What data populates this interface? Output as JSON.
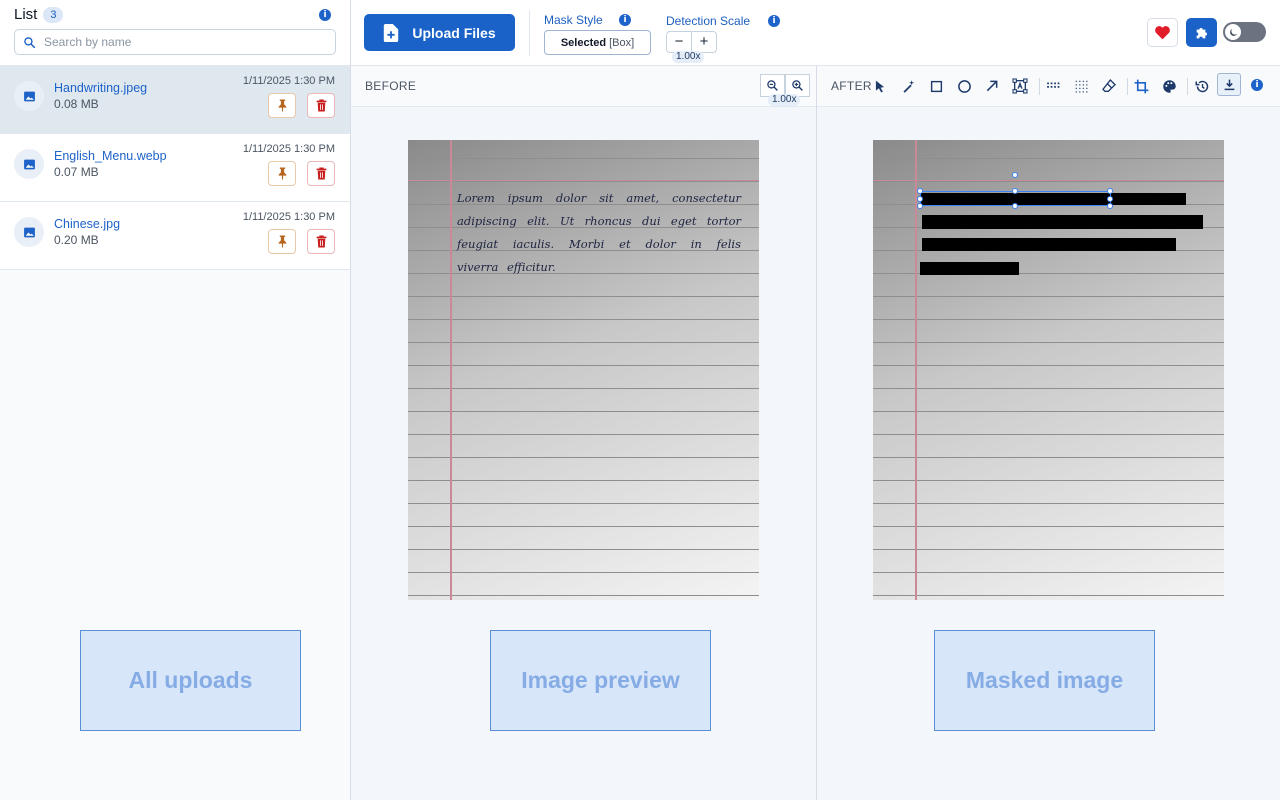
{
  "list": {
    "title": "List",
    "count": "3",
    "search_placeholder": "Search by name",
    "files": [
      {
        "name": "Handwriting.jpeg",
        "size": "0.08 MB",
        "date": "1/11/2025 1:30 PM",
        "active": true
      },
      {
        "name": "English_Menu.webp",
        "size": "0.07 MB",
        "date": "1/11/2025 1:30 PM",
        "active": false
      },
      {
        "name": "Chinese.jpg",
        "size": "0.20 MB",
        "date": "1/11/2025 1:30 PM",
        "active": false
      }
    ]
  },
  "toolbar": {
    "upload_label": "Upload Files",
    "mask_style_label": "Mask Style",
    "mask_style_selected": "Selected",
    "mask_style_value": "[Box]",
    "detection_scale_label": "Detection Scale",
    "detection_scale_minus": "−",
    "detection_scale_plus": "+",
    "detection_scale_value": "1.00x"
  },
  "before": {
    "title": "BEFORE",
    "zoom": "1.00x",
    "text": "Lorem ipsum dolor sit amet, consectetur adipiscing elit. Ut rhoncus dui eget tortor feugiat iaculis. Morbi et dolor in felis viverra efficitur."
  },
  "after": {
    "title": "AFTER"
  },
  "annotations": {
    "all_uploads": "All uploads",
    "image_preview": "Image preview",
    "masked_image": "Masked image"
  },
  "colors": {
    "primary": "#1a62c8",
    "heart": "#e11d2a",
    "pin": "#b5651d",
    "delete": "#c81e1e",
    "annotation_fill": "#d8e6f9",
    "annotation_text": "#86ace5"
  },
  "icons": {
    "search": "search-icon",
    "info": "info-icon",
    "file_thumb": "image-icon",
    "pin": "pin-icon",
    "delete": "trash-icon",
    "upload": "file-plus-icon",
    "heart": "heart-icon",
    "extension": "puzzle-icon",
    "theme": "moon-icon"
  }
}
